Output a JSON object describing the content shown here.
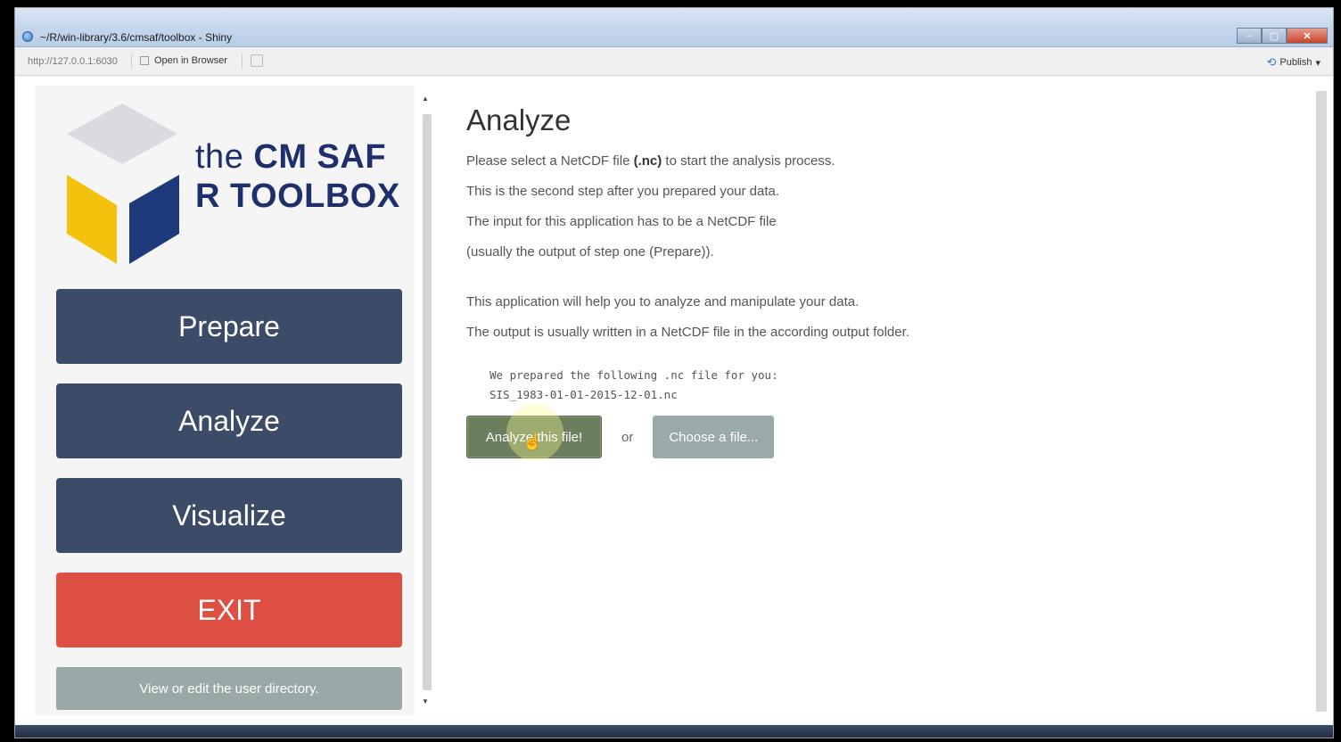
{
  "window": {
    "title": "~/R/win-library/3.6/cmsaf/toolbox - Shiny",
    "minimize": "–",
    "maximize": "▢",
    "close": "✕"
  },
  "addressbar": {
    "url": "http://127.0.0.1:6030",
    "open_in_browser": "Open in Browser",
    "publish": "Publish",
    "publish_caret": "▾"
  },
  "sidebar": {
    "logo": {
      "the": "the",
      "line1": "CM SAF",
      "line2": "R TOOLBOX"
    },
    "nav": [
      {
        "label": "Prepare"
      },
      {
        "label": "Analyze"
      },
      {
        "label": "Visualize"
      }
    ],
    "exit_label": "EXIT",
    "user_dir_label": "View or edit the user directory."
  },
  "main": {
    "heading": "Analyze",
    "intro_prefix": "Please select a NetCDF file ",
    "intro_bold": "(.nc)",
    "intro_suffix": " to start the analysis process.",
    "lines": [
      "This is the second step after you prepared your data.",
      "The input for this application has to be a NetCDF file",
      "(usually the output of step one (Prepare))."
    ],
    "lines2": [
      "This application will help you to analyze and manipulate your data.",
      "The output is usually written in a NetCDF file in the according output folder."
    ],
    "prepared_note": "We prepared the following .nc file for you:",
    "prepared_file": "SIS_1983-01-01-2015-12-01.nc",
    "analyze_button": "Analyze this file!",
    "or_label": "or",
    "choose_button": "Choose a file..."
  },
  "colors": {
    "nav_button": "#3c4c68",
    "exit_button": "#dd4f43",
    "user_dir_button": "#9aa8a8",
    "logo_text": "#1f2f6b"
  }
}
